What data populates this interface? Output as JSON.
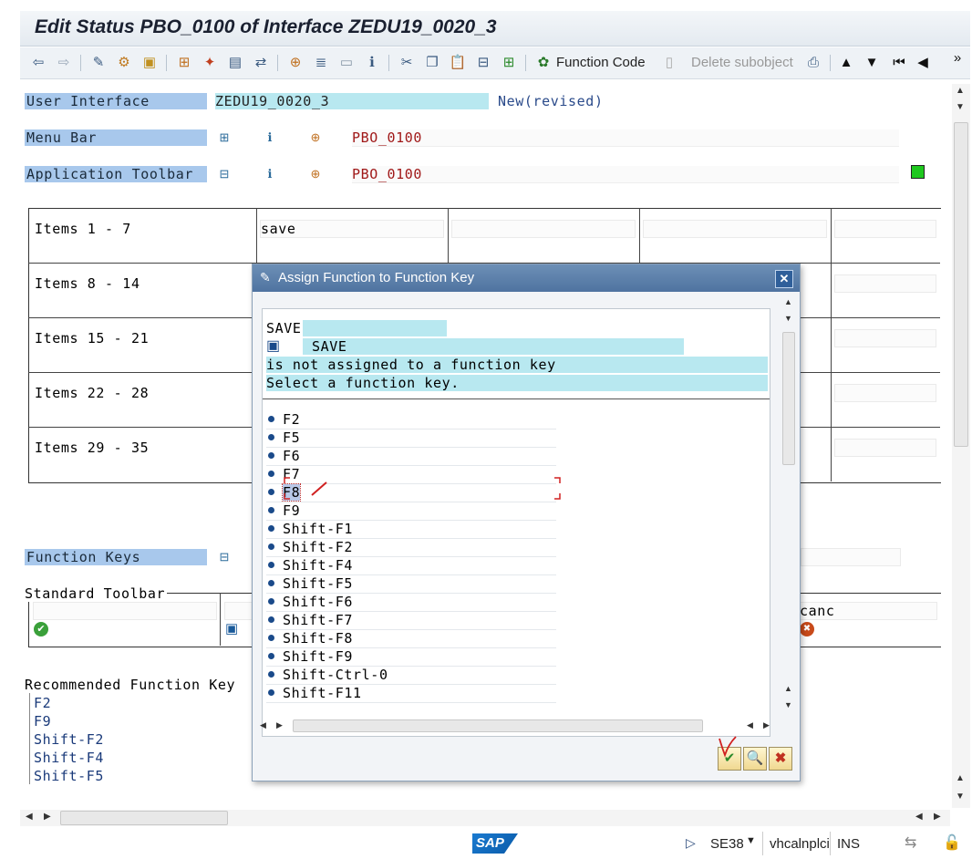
{
  "window": {
    "title": "Edit Status PBO_0100 of Interface ZEDU19_0020_3"
  },
  "toolbar": {
    "function_code_label": "Function Code",
    "delete_subobject_label": "Delete subobject",
    "more_icon": "»"
  },
  "form": {
    "user_interface_label": "User Interface",
    "user_interface_value": "ZEDU19_0020_3",
    "status_text": "New(revised)",
    "menu_bar_label": "Menu Bar",
    "menu_bar_value": "PBO_0100",
    "app_toolbar_label": "Application Toolbar",
    "app_toolbar_value": "PBO_0100"
  },
  "items_grid": {
    "rows": [
      "Items  1 -  7",
      "Items  8 - 14",
      "Items 15 - 21",
      "Items 22 - 28",
      "Items 29 - 35"
    ],
    "first_cell": "save"
  },
  "function_keys": {
    "label": "Function Keys",
    "standard_toolbar_label": "Standard Toolbar",
    "canc_value": "canc"
  },
  "recommended": {
    "label": "Recommended Function Key",
    "keys": [
      "F2",
      "F9",
      "Shift-F2",
      "Shift-F4",
      "Shift-F5"
    ]
  },
  "dialog": {
    "title": "Assign Function to Function Key",
    "function_name": "SAVE",
    "function_text": "SAVE",
    "message_line1": "is not assigned to a function key",
    "message_line2": "Select a function key.",
    "keys": [
      "F2",
      "F5",
      "F6",
      "F7",
      "F8",
      "F9",
      "Shift-F1",
      "Shift-F2",
      "Shift-F4",
      "Shift-F5",
      "Shift-F6",
      "Shift-F7",
      "Shift-F8",
      "Shift-F9",
      "Shift-Ctrl-0",
      "Shift-F11"
    ],
    "selected_key": "F8"
  },
  "statusbar": {
    "logo": "SAP",
    "transaction": "SE38",
    "server": "vhcalnplci",
    "mode": "INS"
  },
  "colors": {
    "label_bg": "#a8c8ec",
    "cyan_field": "#b8e8f0",
    "status_green": "#1ec81e",
    "value_red": "#a01818"
  }
}
